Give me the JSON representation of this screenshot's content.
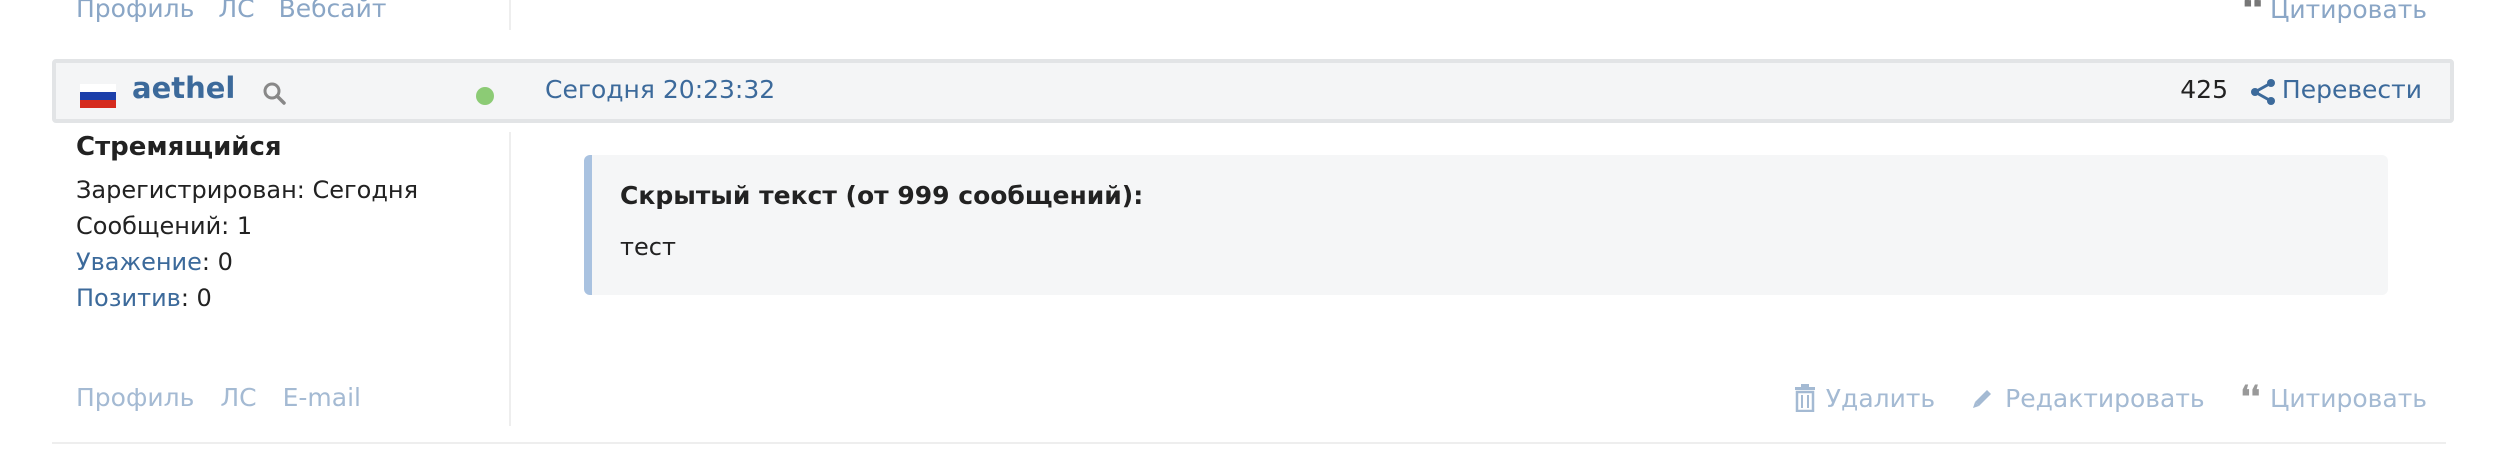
{
  "previous_post": {
    "links": [
      "Профиль",
      "ЛС",
      "Вебсайт"
    ],
    "quote_label": "Цитировать"
  },
  "post": {
    "flag_colors": [
      "#ffffff",
      "#1c3faa",
      "#d52b1e"
    ],
    "username": "aethel",
    "online_color": "#8ccb75",
    "timestamp": "Сегодня 20:23:32",
    "post_number": "425",
    "share_icon": "share-icon",
    "translate_label": "Перевести",
    "user": {
      "rank": "Стремящийся",
      "registered_label": "Зарегистрирован:",
      "registered_value": "Сегодня",
      "messages_label": "Сообщений:",
      "messages_value": "1",
      "respect_label": "Уважение",
      "respect_value": "0",
      "positive_label": "Позитив",
      "positive_value": "0"
    },
    "hidden_text": {
      "title": "Скрытый текст (от 999 сообщений):",
      "body": "тест"
    },
    "footer_links": [
      "Профиль",
      "ЛС",
      "E-mail"
    ],
    "actions": {
      "delete_label": "Удалить",
      "edit_label": "Редактировать",
      "quote_label": "Цитировать"
    }
  }
}
